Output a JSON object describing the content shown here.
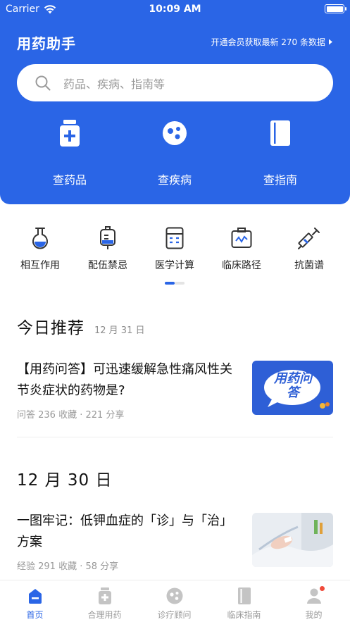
{
  "status_bar": {
    "carrier": "Carrier",
    "time": "10:09 AM"
  },
  "header": {
    "title": "用药助手",
    "promo": "开通会员获取最新 270 条数据",
    "accent": "#2a65e6"
  },
  "search": {
    "placeholder": "药品、疾病、指南等"
  },
  "quick": [
    {
      "label": "查药品",
      "icon": "medicine-bottle-icon"
    },
    {
      "label": "查疾病",
      "icon": "virus-icon"
    },
    {
      "label": "查指南",
      "icon": "book-icon"
    }
  ],
  "tools": [
    {
      "label": "相互作用",
      "icon": "flask-icon"
    },
    {
      "label": "配伍禁忌",
      "icon": "iv-bag-icon"
    },
    {
      "label": "医学计算",
      "icon": "calculator-icon"
    },
    {
      "label": "临床路径",
      "icon": "clipboard-icon"
    },
    {
      "label": "抗菌谱",
      "icon": "syringe-icon"
    }
  ],
  "sections": [
    {
      "heading": "今日推荐",
      "date": "12 月 31 日",
      "article": {
        "title": "【用药问答】可迅速缓解急性痛风性关节炎症状的药物是?",
        "meta": "问答 236 收藏 · 221 分享",
        "thumb_text": "用药问答"
      }
    },
    {
      "heading": "12 月 30 日",
      "date": "",
      "article": {
        "title": "一图牢记：低钾血症的「诊」与「治」方案",
        "meta": "经验 291 收藏 · 58 分享"
      }
    }
  ],
  "tabbar": [
    {
      "label": "首页",
      "icon": "home-icon",
      "active": true
    },
    {
      "label": "合理用药",
      "icon": "medicine-icon",
      "active": false
    },
    {
      "label": "诊疗顾问",
      "icon": "consult-icon",
      "active": false
    },
    {
      "label": "临床指南",
      "icon": "guide-icon",
      "active": false
    },
    {
      "label": "我的",
      "icon": "profile-icon",
      "active": false,
      "badge": true
    }
  ]
}
